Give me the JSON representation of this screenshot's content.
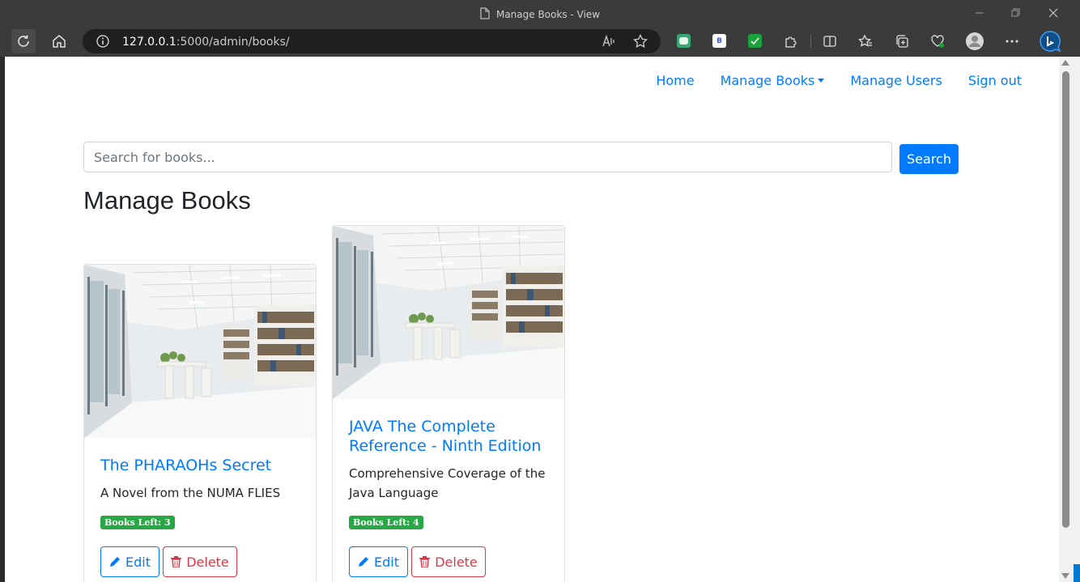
{
  "browser": {
    "window_title": "Manage Books - View",
    "url_host": "127.0.0.1",
    "url_path": ":5000/admin/books/",
    "extension_b_label": "B"
  },
  "nav": {
    "home": "Home",
    "manage_books": "Manage Books",
    "manage_users": "Manage Users",
    "sign_out": "Sign out"
  },
  "search": {
    "placeholder": "Search for books...",
    "button_label": "Search"
  },
  "page_title": "Manage Books",
  "books": [
    {
      "title": "The PHARAOHs Secret",
      "description": "A Novel from the NUMA FLIES",
      "badge": "Books Left: 3",
      "edit_label": "Edit",
      "delete_label": "Delete"
    },
    {
      "title": "JAVA The Complete Reference - Ninth Edition",
      "description": "Comprehensive Coverage of the Java Language",
      "badge": "Books Left: 4",
      "edit_label": "Edit",
      "delete_label": "Delete"
    }
  ],
  "colors": {
    "primary": "#007bff",
    "danger": "#dc3545",
    "success": "#28a745",
    "chrome": "#3b3b3b"
  },
  "icons": [
    "page-icon",
    "minimize-icon",
    "restore-icon",
    "close-icon",
    "refresh-icon",
    "home-icon",
    "info-icon",
    "read-aloud-icon",
    "favorite-star-icon",
    "puzzle-extension-icon",
    "split-screen-icon",
    "favorites-icon",
    "collections-icon",
    "health-icon",
    "profile-avatar-icon",
    "more-icon",
    "bing-icon",
    "pencil-icon",
    "trash-icon"
  ]
}
